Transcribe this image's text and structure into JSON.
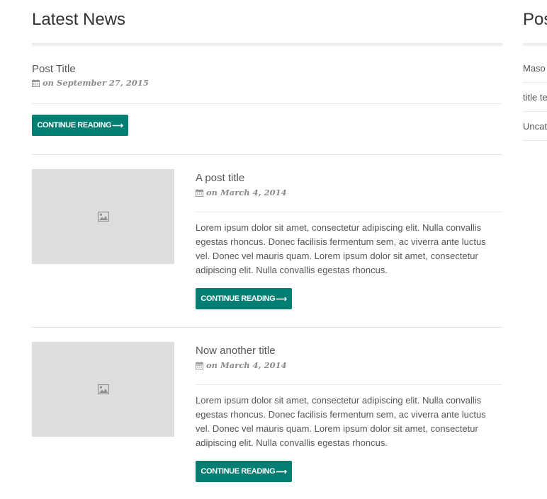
{
  "main": {
    "section_title": "Latest News",
    "posts": [
      {
        "title": "Post Title",
        "date": "on September 27, 2015",
        "button_label": "CONTINUE READING",
        "button_arrow": "⟶"
      },
      {
        "title": "A post title",
        "date": "on March 4, 2014",
        "excerpt": "Lorem ipsum dolor sit amet, consectetur adipiscing elit. Nulla convallis egestas rhoncus. Donec facilisis fermentum sem, ac viverra ante luctus vel. Donec vel mauris quam. Lorem ipsum dolor sit amet, consectetur adipiscing elit. Nulla convallis egestas rhoncus.",
        "button_label": "CONTINUE READING",
        "button_arrow": "⟶"
      },
      {
        "title": "Now another title",
        "date": "on March 4, 2014",
        "excerpt": "Lorem ipsum dolor sit amet, consectetur adipiscing elit. Nulla convallis egestas rhoncus. Donec facilisis fermentum sem, ac viverra ante luctus vel. Donec vel mauris quam. Lorem ipsum dolor sit amet, consectetur adipiscing elit. Nulla convallis egestas rhoncus.",
        "button_label": "CONTINUE READING",
        "button_arrow": "⟶"
      }
    ]
  },
  "sidebar": {
    "title": "Pos",
    "items": [
      "Maso",
      "title te",
      "Uncat"
    ]
  },
  "colors": {
    "accent": "#037e73",
    "thumb_bg": "#dddddd",
    "text": "#555555",
    "heading": "#333333"
  },
  "icons": {
    "meta": "calendar-icon",
    "thumbnail": "image-placeholder-icon"
  }
}
